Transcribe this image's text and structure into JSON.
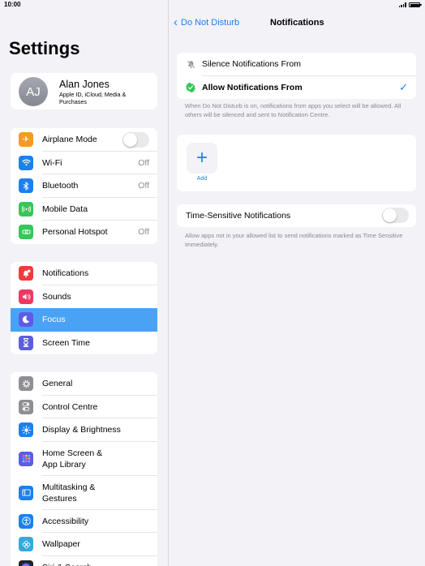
{
  "status": {
    "time": "10:00",
    "battery_level": 1.0
  },
  "sidebar": {
    "title": "Settings",
    "profile": {
      "initials": "AJ",
      "name": "Alan Jones",
      "subtitle": "Apple ID, iCloud, Media & Purchases"
    },
    "group1": [
      {
        "label": "Airplane Mode",
        "icon": "airplane-icon",
        "color": "#f59a23",
        "toggle": false
      },
      {
        "label": "Wi-Fi",
        "icon": "wifi-icon",
        "color": "#1e7ff0",
        "value": "Off"
      },
      {
        "label": "Bluetooth",
        "icon": "bluetooth-icon",
        "color": "#1e7ff0",
        "value": "Off"
      },
      {
        "label": "Mobile Data",
        "icon": "antenna-icon",
        "color": "#34c759"
      },
      {
        "label": "Personal Hotspot",
        "icon": "link-icon",
        "color": "#34c759",
        "value": "Off"
      }
    ],
    "group2": [
      {
        "label": "Notifications",
        "icon": "bell-badge-icon",
        "color": "#ef3b3b"
      },
      {
        "label": "Sounds",
        "icon": "speaker-icon",
        "color": "#ef3860"
      },
      {
        "label": "Focus",
        "icon": "moon-icon",
        "color": "#5d5ce6",
        "selected": true
      },
      {
        "label": "Screen Time",
        "icon": "hourglass-icon",
        "color": "#5d5ce6"
      }
    ],
    "group3": [
      {
        "label": "General",
        "icon": "gear-icon",
        "color": "#8e8e93"
      },
      {
        "label": "Control Centre",
        "icon": "switches-icon",
        "color": "#8e8e93"
      },
      {
        "label": "Display & Brightness",
        "icon": "sun-icon",
        "color": "#1e7ff0"
      },
      {
        "label": "Home Screen & App Library",
        "icon": "app-grid-icon",
        "color": "#5d5ce6"
      },
      {
        "label": "Multitasking & Gestures",
        "icon": "multitask-icon",
        "color": "#1e7ff0"
      },
      {
        "label": "Accessibility",
        "icon": "accessibility-icon",
        "color": "#1e7ff0"
      },
      {
        "label": "Wallpaper",
        "icon": "flower-icon",
        "color": "#34aadc"
      },
      {
        "label": "Siri & Search",
        "icon": "siri-icon",
        "color": "#222"
      }
    ]
  },
  "detail": {
    "back_label": "Do Not Disturb",
    "title": "Notifications",
    "options": [
      {
        "label": "Silence Notifications From",
        "icon": "bell-slash-icon",
        "checked": false
      },
      {
        "label": "Allow Notifications From",
        "icon": "check-badge-icon",
        "checked": true
      }
    ],
    "options_footnote": "When Do Not Disturb is on, notifications from apps you select will be allowed. All others will be silenced and sent to Notification Centre.",
    "add_symbol": "+",
    "add_label": "Add",
    "time_sensitive": {
      "label": "Time-Sensitive Notifications",
      "enabled": false,
      "footnote": "Allow apps not in your allowed list to send notifications marked as Time Sensitive immediately."
    }
  }
}
